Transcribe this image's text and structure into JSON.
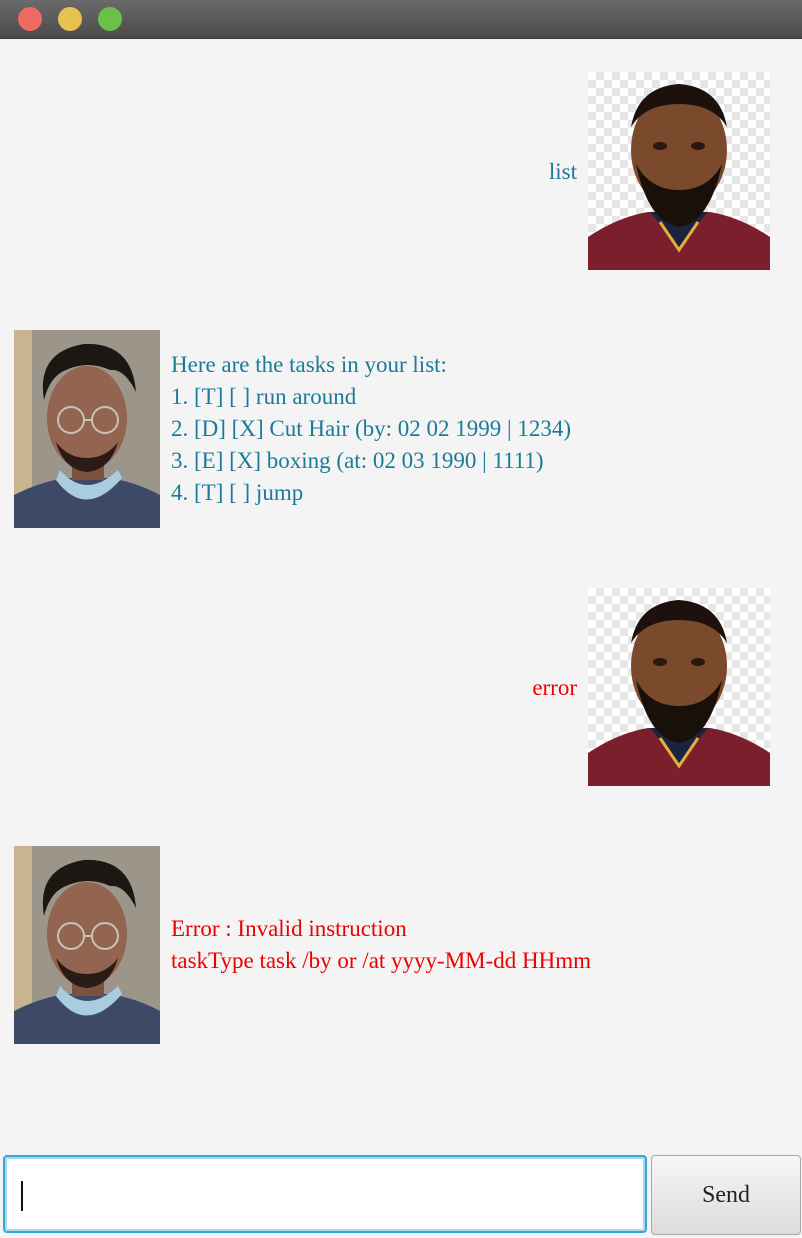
{
  "window": {
    "traffic_lights": [
      "close",
      "minimize",
      "maximize"
    ]
  },
  "colors": {
    "user_text": "#1b7a9a",
    "error_text": "#ee0000"
  },
  "dialog": [
    {
      "speaker": "user",
      "text": "list"
    },
    {
      "speaker": "bot",
      "lines": [
        "Here are the tasks in your list:",
        "1. [T] [ ] run around",
        "2. [D] [X] Cut Hair (by: 02 02 1999 | 1234)",
        "3. [E] [X] boxing (at: 02 03 1990 | 1111)",
        "4. [T] [ ] jump"
      ]
    },
    {
      "speaker": "user",
      "text": "error"
    },
    {
      "speaker": "bot",
      "lines": [
        "Error : Invalid instruction",
        "taskType task /by or /at yyyy-MM-dd HHmm"
      ]
    }
  ],
  "input": {
    "value": ""
  },
  "send_label": "Send"
}
